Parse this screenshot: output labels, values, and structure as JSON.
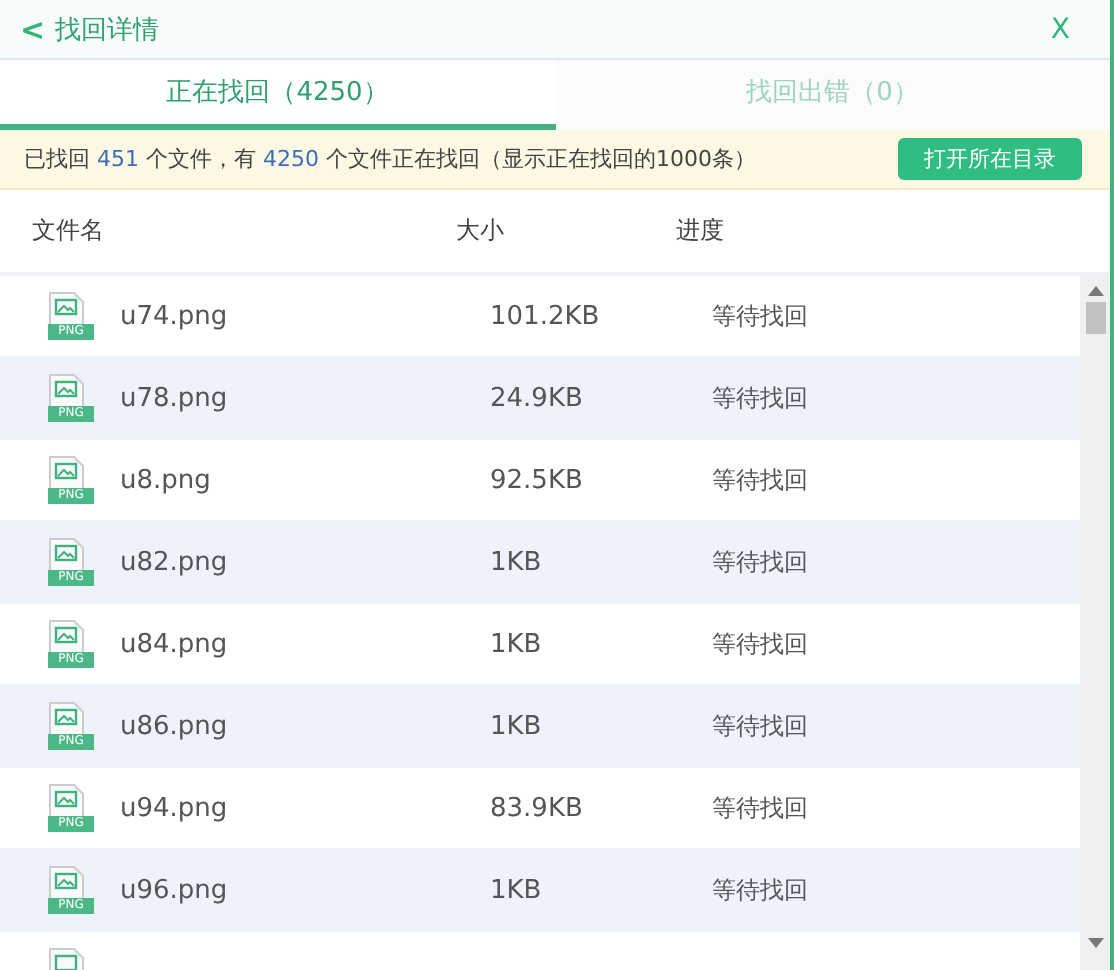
{
  "header": {
    "back_icon": "<",
    "title": "找回详情",
    "close": "X"
  },
  "tabs": [
    {
      "label": "正在找回（4250）",
      "selected": true
    },
    {
      "label": "找回出错（0）",
      "selected": false
    }
  ],
  "info_bar": {
    "segments": [
      {
        "kind": "text",
        "text": "已找回 "
      },
      {
        "kind": "number",
        "text": "451"
      },
      {
        "kind": "text",
        "text": " 个文件，有 "
      },
      {
        "kind": "number",
        "text": "4250"
      },
      {
        "kind": "text",
        "text": " 个文件正在找回（显示正在找回的1000条）"
      }
    ],
    "button": "打开所在目录"
  },
  "table": {
    "columns": [
      "文件名",
      "大小",
      "进度"
    ],
    "rows": [
      {
        "icon_label": "PNG",
        "name": "u74.png",
        "size": "101.2KB",
        "status": "等待找回"
      },
      {
        "icon_label": "PNG",
        "name": "u78.png",
        "size": "24.9KB",
        "status": "等待找回"
      },
      {
        "icon_label": "PNG",
        "name": "u8.png",
        "size": "92.5KB",
        "status": "等待找回"
      },
      {
        "icon_label": "PNG",
        "name": "u82.png",
        "size": "1KB",
        "status": "等待找回"
      },
      {
        "icon_label": "PNG",
        "name": "u84.png",
        "size": "1KB",
        "status": "等待找回"
      },
      {
        "icon_label": "PNG",
        "name": "u86.png",
        "size": "1KB",
        "status": "等待找回"
      },
      {
        "icon_label": "PNG",
        "name": "u94.png",
        "size": "83.9KB",
        "status": "等待找回"
      },
      {
        "icon_label": "PNG",
        "name": "u96.png",
        "size": "1KB",
        "status": "等待找回"
      }
    ]
  }
}
